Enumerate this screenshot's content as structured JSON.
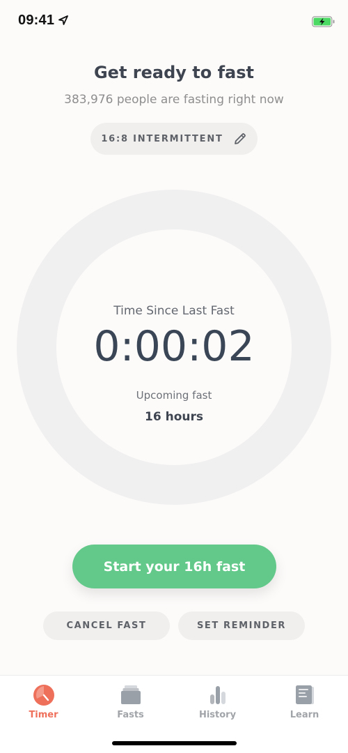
{
  "status_bar": {
    "time": "09:41",
    "icons": [
      "location-arrow-icon",
      "battery-charging-icon"
    ],
    "battery_color": "#4cd964"
  },
  "header": {
    "title": "Get ready to fast",
    "subtitle": "383,976 people are fasting right now"
  },
  "plan": {
    "label": "16:8 INTERMITTENT",
    "icon": "pencil-icon"
  },
  "timer": {
    "label": "Time Since Last Fast",
    "value": "0:00:02",
    "upcoming_label": "Upcoming fast",
    "upcoming_value": "16 hours",
    "progress": 0
  },
  "actions": {
    "start_label": "Start your 16h fast",
    "cancel_label": "CANCEL FAST",
    "reminder_label": "SET REMINDER"
  },
  "tab_bar": {
    "items": [
      {
        "label": "Timer",
        "icon": "timer-icon",
        "active": true
      },
      {
        "label": "Fasts",
        "icon": "fasts-stack-icon",
        "active": false
      },
      {
        "label": "History",
        "icon": "history-chart-icon",
        "active": false
      },
      {
        "label": "Learn",
        "icon": "learn-book-icon",
        "active": false
      }
    ]
  },
  "colors": {
    "accent_green": "#63c98a",
    "accent_coral": "#ee6f5a",
    "background": "#fdfbfa",
    "ring": "#f1f0f0",
    "inactive_tab": "#a1a4a8"
  }
}
